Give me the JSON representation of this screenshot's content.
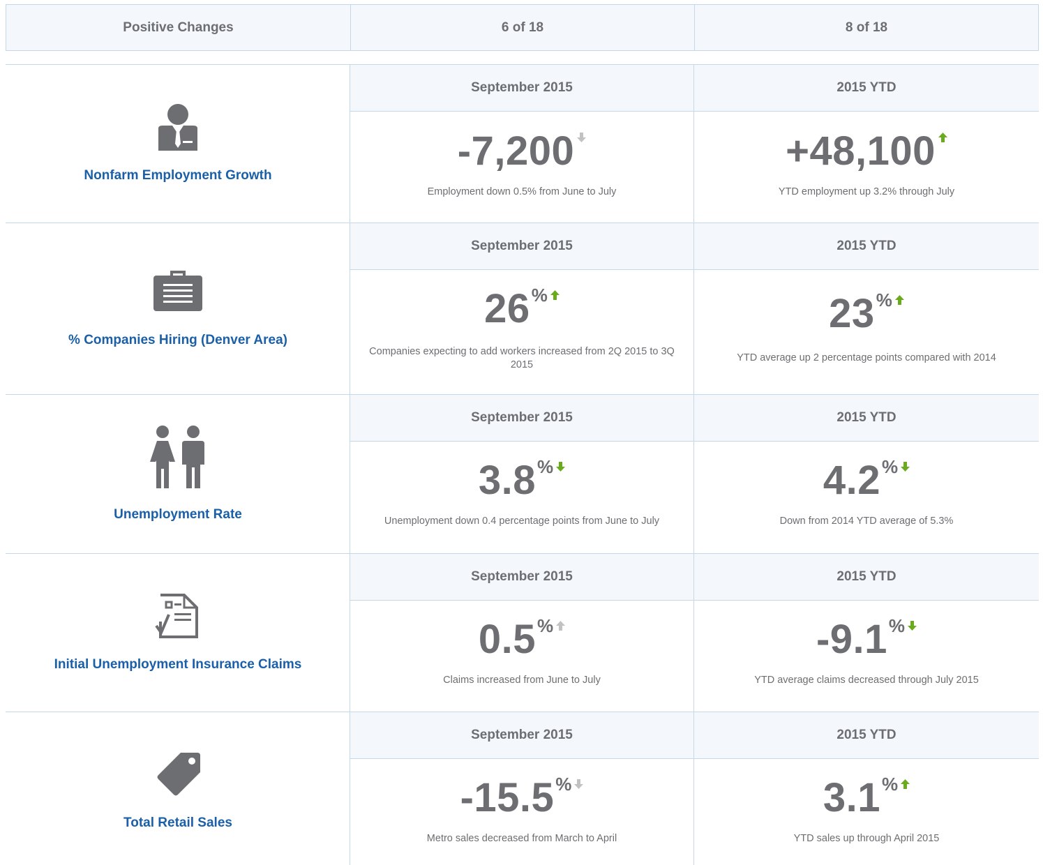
{
  "summary": {
    "label": "Positive Changes",
    "period1": "6 of 18",
    "period2": "8 of 18"
  },
  "colors": {
    "label_blue": "#1a5fa8",
    "text_gray": "#6d6e71",
    "arrow_green": "#6aab1e",
    "arrow_gray": "#c2c2c2",
    "border": "#c5d8ea",
    "header_bg": "#f4f8fc"
  },
  "indicators": [
    {
      "icon": "businessman-icon",
      "label": "Nonfarm Employment Growth",
      "sep": {
        "header": "September 2015",
        "value": "-7,200",
        "unit": "",
        "direction": "down",
        "trend_color": "gray",
        "description": "Employment down 0.5% from June to July"
      },
      "ytd": {
        "header": "2015 YTD",
        "value": "+48,100",
        "unit": "",
        "direction": "up",
        "trend_color": "green",
        "description": "YTD employment up 3.2% through July"
      }
    },
    {
      "icon": "briefcase-icon",
      "label": "% Companies Hiring (Denver Area)",
      "sep": {
        "header": "September 2015",
        "value": "26",
        "unit": "%",
        "direction": "up",
        "trend_color": "green",
        "description": "Companies expecting to add workers increased from 2Q 2015 to 3Q 2015"
      },
      "ytd": {
        "header": "2015 YTD",
        "value": "23",
        "unit": "%",
        "direction": "up",
        "trend_color": "green",
        "description": "YTD average up 2 percentage points compared with 2014"
      }
    },
    {
      "icon": "people-icon",
      "label": "Unemployment Rate",
      "sep": {
        "header": "September 2015",
        "value": "3.8",
        "unit": "%",
        "direction": "down",
        "trend_color": "green",
        "description": "Unemployment down 0.4 percentage points from June to July"
      },
      "ytd": {
        "header": "2015 YTD",
        "value": "4.2",
        "unit": "%",
        "direction": "down",
        "trend_color": "green",
        "description": "Down from 2014 YTD average of 5.3%"
      }
    },
    {
      "icon": "claim-form-icon",
      "label": "Initial Unemployment Insurance Claims",
      "sep": {
        "header": "September 2015",
        "value": "0.5",
        "unit": "%",
        "direction": "up",
        "trend_color": "gray",
        "description": "Claims increased from June to July"
      },
      "ytd": {
        "header": "2015 YTD",
        "value": "-9.1",
        "unit": "%",
        "direction": "down",
        "trend_color": "green",
        "description": "YTD average claims decreased through July 2015"
      }
    },
    {
      "icon": "price-tag-icon",
      "label": "Total Retail Sales",
      "sep": {
        "header": "September 2015",
        "value": "-15.5",
        "unit": "%",
        "direction": "down",
        "trend_color": "gray",
        "description": "Metro sales decreased from March to April"
      },
      "ytd": {
        "header": "2015 YTD",
        "value": "3.1",
        "unit": "%",
        "direction": "up",
        "trend_color": "green",
        "description": "YTD sales up through April 2015"
      }
    }
  ]
}
